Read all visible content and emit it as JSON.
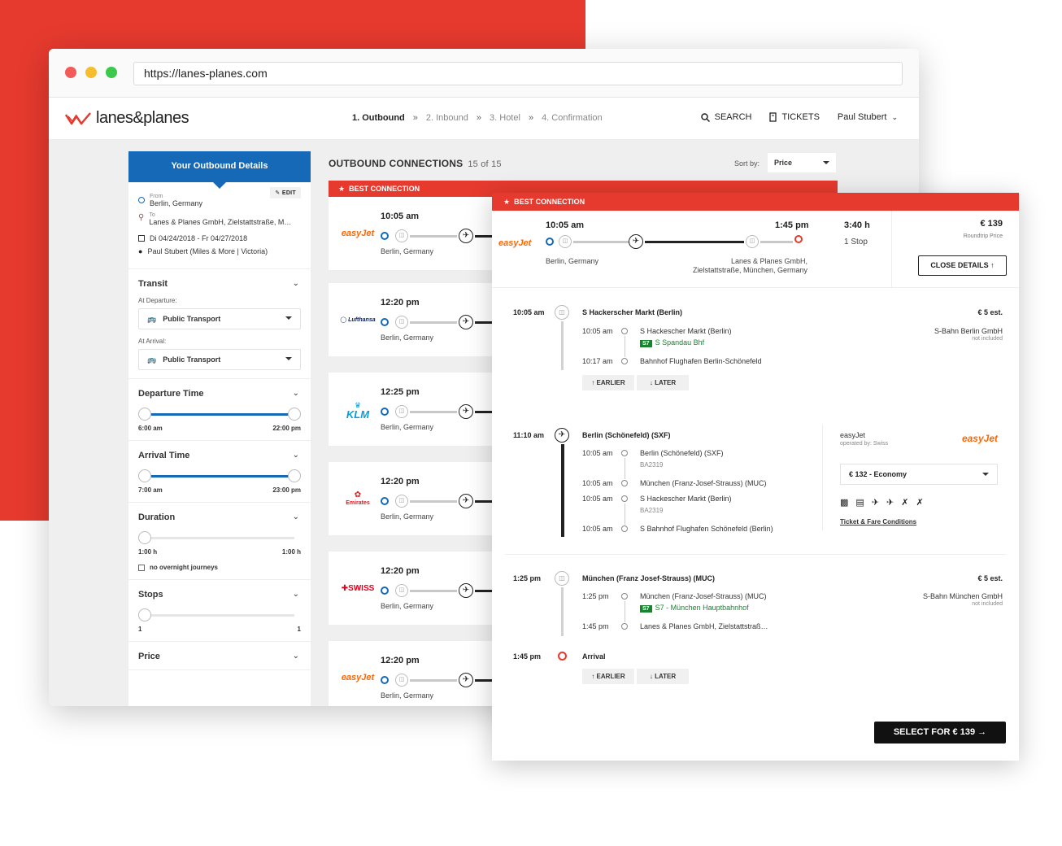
{
  "browser": {
    "url": "https://lanes-planes.com"
  },
  "nav": {
    "logo_text": "lanes&planes",
    "steps": [
      {
        "label": "1. Outbound"
      },
      {
        "label": "2. Inbound"
      },
      {
        "label": "3. Hotel"
      },
      {
        "label": "4. Confirmation"
      }
    ],
    "step_sep": "»",
    "search_label": "SEARCH",
    "tickets_label": "TICKETS",
    "user_name": "Paul Stubert"
  },
  "sidebar": {
    "header": "Your Outbound Details",
    "edit_label": "EDIT",
    "from_label": "From",
    "from_value": "Berlin, Germany",
    "to_label": "To",
    "to_value": "Lanes & Planes GmbH, Zielstattstraße, M…",
    "dates": "Di 04/24/2018 - Fr 04/27/2018",
    "traveler": "Paul Stubert (Miles & More | Victoria)",
    "transit": {
      "title": "Transit",
      "departure_label": "At Departure:",
      "departure_value": "Public Transport",
      "arrival_label": "At Arrival:",
      "arrival_value": "Public Transport"
    },
    "departure_time": {
      "title": "Departure Time",
      "min": "6:00 am",
      "max": "22:00 pm"
    },
    "arrival_time": {
      "title": "Arrival Time",
      "min": "7:00 am",
      "max": "23:00 pm"
    },
    "duration": {
      "title": "Duration",
      "min": "1:00 h",
      "max": "1:00 h",
      "overnight_label": "no overnight journeys"
    },
    "stops": {
      "title": "Stops",
      "min": "1",
      "max": "1"
    },
    "price": {
      "title": "Price"
    }
  },
  "connections": {
    "title": "OUTBOUND CONNECTIONS",
    "count": "15 of 15",
    "sort_label": "Sort by:",
    "sort_value": "Price",
    "best_label": "BEST CONNECTION",
    "items": [
      {
        "airline": "easyJet",
        "time": "10:05 am",
        "city": "Berlin, Germany"
      },
      {
        "airline": "Lufthansa",
        "time": "12:20 pm",
        "city": "Berlin, Germany"
      },
      {
        "airline": "KLM",
        "time": "12:25 pm",
        "city": "Berlin, Germany"
      },
      {
        "airline": "Emirates",
        "time": "12:20 pm",
        "city": "Berlin, Germany"
      },
      {
        "airline": "SWISS",
        "time": "12:20 pm",
        "city": "Berlin, Germany"
      },
      {
        "airline": "easyJet",
        "time": "12:20 pm",
        "city": "Berlin, Germany"
      }
    ]
  },
  "detail": {
    "banner": "BEST CONNECTION",
    "airline": "easyJet",
    "dep_time": "10:05 am",
    "arr_time": "1:45 pm",
    "duration": "3:40 h",
    "stops": "1 Stop",
    "price": "€ 139",
    "price_note": "Roundtrip Price",
    "dep_city": "Berlin, Germany",
    "arr_city_1": "Lanes & Planes GmbH,",
    "arr_city_2": "Zielstattstraße, München, Germany",
    "close_label": "CLOSE DETAILS",
    "seg1": {
      "time": "10:05 am",
      "title": "S Hackerscher Markt (Berlin)",
      "price": "€ 5 est.",
      "operator": "S-Bahn Berlin GmbH",
      "note": "not included",
      "s1_time": "10:05 am",
      "s1_name": "S Hackescher Markt (Berlin)",
      "line": "S7",
      "line_dir": "S Spandau Bhf",
      "s2_time": "10:17 am",
      "s2_name": "Bahnhof Flughafen Berlin-Schönefeld",
      "earlier": "EARLIER",
      "later": "LATER"
    },
    "seg2": {
      "time": "11:10 am",
      "title": "Berlin (Schönefeld) (SXF)",
      "s1_time": "10:05 am",
      "s1_name": "Berlin (Schönefeld) (SXF)",
      "s1_code": "BA2319",
      "s2_time": "10:05 am",
      "s2_name": "München (Franz-Josef-Strauss) (MUC)",
      "s3_time": "10:05 am",
      "s3_name": "S Hackescher Markt (Berlin)",
      "s3_code": "BA2319",
      "s4_time": "10:05 am",
      "s4_name": "S Bahnhof Flughafen Schönefeld (Berlin)",
      "carrier": "easyJet",
      "operated": "operated by: Swiss",
      "fare": "€ 132 - Economy",
      "conditions": "Ticket & Fare Conditions"
    },
    "seg3": {
      "time": "1:25 pm",
      "title": "München (Franz Josef-Strauss) (MUC)",
      "price": "€ 5 est.",
      "operator": "S-Bahn München GmbH",
      "note": "not included",
      "s1_time": "1:25 pm",
      "s1_name": "München (Franz-Josef-Strauss) (MUC)",
      "line": "S7",
      "line_dir": "S7 - München Hauptbahnhof",
      "s2_time": "1:45 pm",
      "s2_name": "Lanes & Planes GmbH, Zielstattstraß…"
    },
    "arrival": {
      "time": "1:45 pm",
      "label": "Arrival",
      "earlier": "EARLIER",
      "later": "LATER"
    },
    "select_label": "SELECT FOR € 139"
  }
}
